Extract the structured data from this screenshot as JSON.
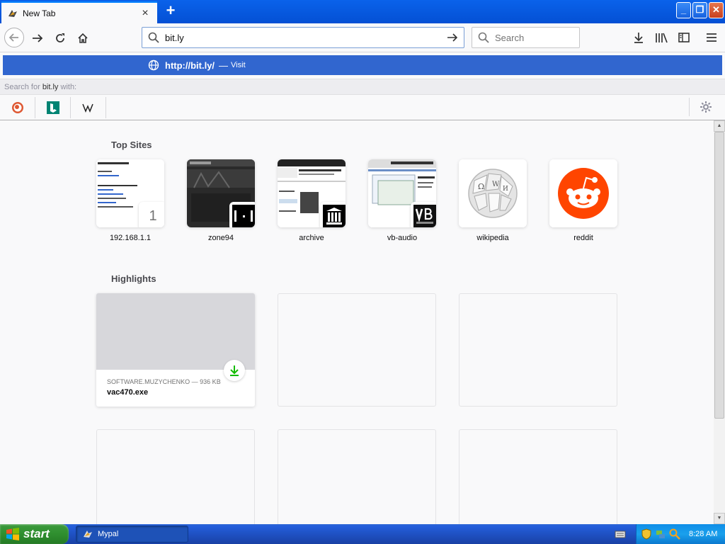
{
  "window": {
    "tab_title": "New Tab",
    "tab_close": "×",
    "new_tab": "+",
    "minimize": "_",
    "restore": "❐",
    "close": "✕"
  },
  "navbar": {
    "url_value": "bit.ly",
    "search_placeholder": "Search"
  },
  "url_popup": {
    "suggestion_url": "http://bit.ly/",
    "suggestion_sep": "—",
    "suggestion_action": "Visit",
    "search_for_prefix": "Search for ",
    "search_for_query": "bit.ly",
    "search_for_suffix": " with:",
    "engines": [
      "DuckDuckGo",
      "Bing",
      "Wikipedia"
    ]
  },
  "top_sites": {
    "title": "Top Sites",
    "tiles": [
      {
        "label": "192.168.1.1",
        "badge": "1"
      },
      {
        "label": "zone94"
      },
      {
        "label": "archive"
      },
      {
        "label": "vb-audio"
      },
      {
        "label": "wikipedia"
      },
      {
        "label": "reddit"
      }
    ]
  },
  "highlights": {
    "title": "Highlights",
    "items": [
      {
        "source": "SOFTWARE.MUZYCHENKO — 936 KB",
        "title": "vac470.exe"
      }
    ]
  },
  "taskbar": {
    "start_label": "start",
    "task_item": "Mypal",
    "clock": "8:28 AM"
  },
  "colors": {
    "accent_blue": "#3166cf",
    "xp_taskbar": "#245edb",
    "start_green": "#2f8f2f",
    "reddit_orange": "#ff4500",
    "download_green": "#12bc00"
  }
}
